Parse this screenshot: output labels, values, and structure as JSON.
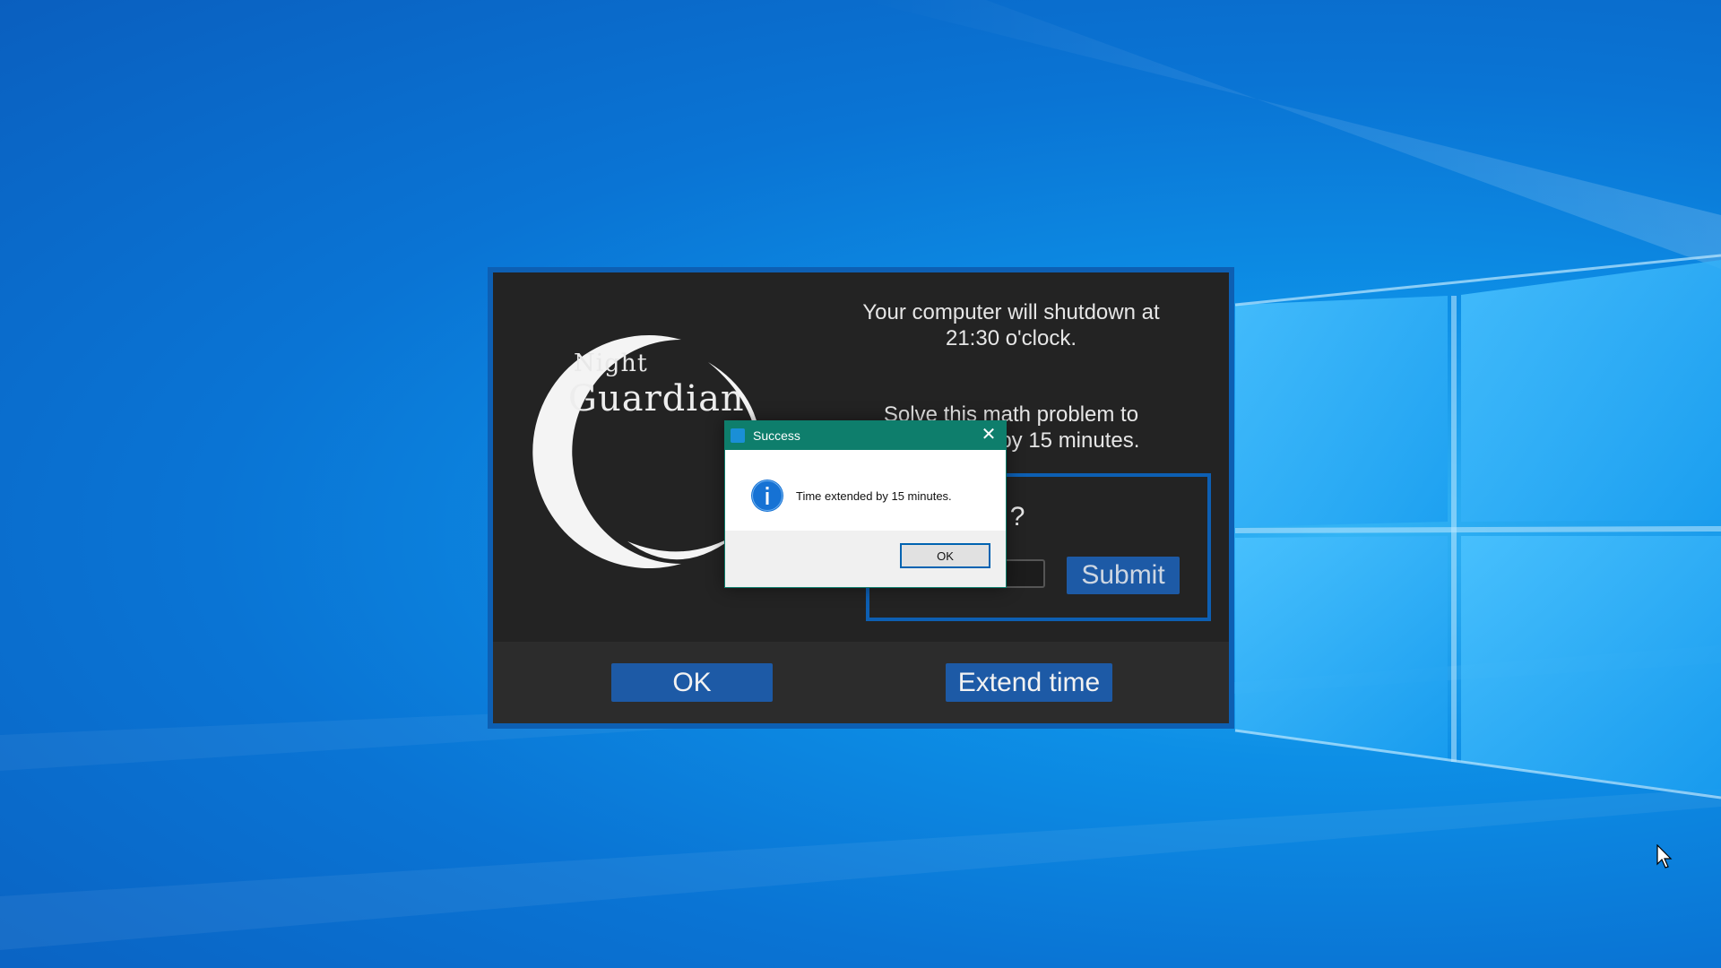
{
  "main_window": {
    "logo": {
      "line1": "Night",
      "line2": "Guardian"
    },
    "shutdown_message": "Your computer will shutdown at 21:30 o'clock.",
    "solve_message": "Solve this math problem to extend time by 15 minutes.",
    "math_problem": "+ 3 = ?",
    "answer_value": "",
    "submit_label": "Submit",
    "ok_label": "OK",
    "extend_label": "Extend time",
    "accent_color": "#1d5aa6"
  },
  "dialog": {
    "title": "Success",
    "close_glyph": "✕",
    "message": "Time extended by 15 minutes.",
    "ok_label": "OK",
    "icon": "info-icon",
    "titlebar_color": "#0e7e6c"
  }
}
